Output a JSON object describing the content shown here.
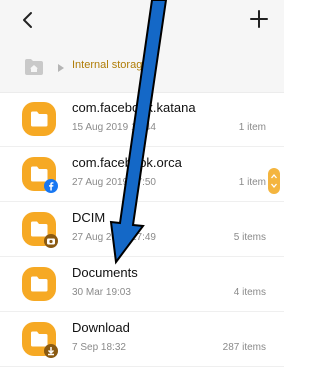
{
  "colors": {
    "accent": "#f6a924",
    "arrow": "#1468c7",
    "background": "#ffffff",
    "bar": "#f6f6f6",
    "breadcrumb": "#b07d07"
  },
  "toolbar": {
    "back_icon": "chevron-left-icon",
    "add_icon": "plus-icon"
  },
  "breadcrumb": {
    "home_icon": "home-folder-icon",
    "label": "Internal storage"
  },
  "items": [
    {
      "name": "com.facebook.katana",
      "date": "15 Aug 2019 19:44",
      "count": "1 item",
      "badge": ""
    },
    {
      "name": "com.facebook.orca",
      "date": "27 Aug 2019 17:50",
      "count": "1 item",
      "badge": "facebook-icon"
    },
    {
      "name": "DCIM",
      "date": "27 Aug 2019 17:49",
      "count": "5 items",
      "badge": "camera-icon"
    },
    {
      "name": "Documents",
      "date": "30 Mar 19:03",
      "count": "4 items",
      "badge": ""
    },
    {
      "name": "Download",
      "date": "7 Sep 18:32",
      "count": "287 items",
      "badge": "download-icon"
    }
  ]
}
